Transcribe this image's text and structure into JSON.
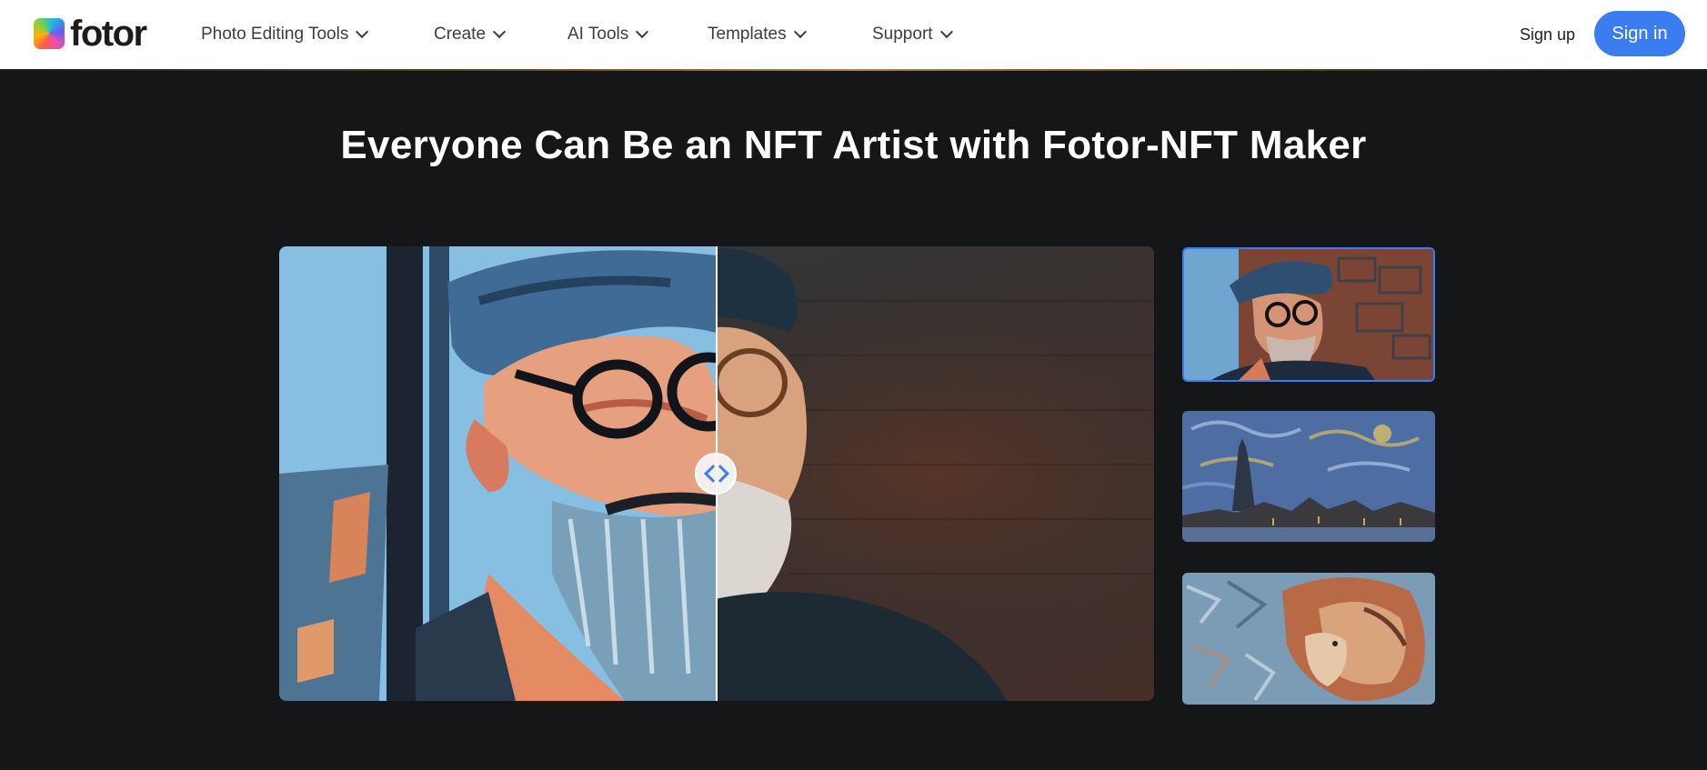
{
  "header": {
    "logo_text": "fotor",
    "nav": [
      {
        "label": "Photo Editing Tools",
        "has_dropdown": true
      },
      {
        "label": "Create",
        "has_dropdown": true
      },
      {
        "label": "AI Tools",
        "has_dropdown": true
      },
      {
        "label": "Templates",
        "has_dropdown": true
      },
      {
        "label": "Support",
        "has_dropdown": true
      }
    ],
    "signup_label": "Sign up",
    "signin_label": "Sign in"
  },
  "hero": {
    "title": "Everyone Can Be an NFT Artist with Fotor-NFT Maker"
  },
  "comparison": {
    "left_image": "old man painted NFT style",
    "right_image": "old man original photo",
    "handle_icon": "left-right-arrows-icon"
  },
  "thumbnails": [
    {
      "name": "old-man-nft",
      "selected": true
    },
    {
      "name": "statue-of-liberty-van-gogh",
      "selected": false
    },
    {
      "name": "lion-painted",
      "selected": false
    }
  ],
  "colors": {
    "accent": "#3b7cf1",
    "page_bg": "#151617",
    "header_bg": "#ffffff"
  }
}
